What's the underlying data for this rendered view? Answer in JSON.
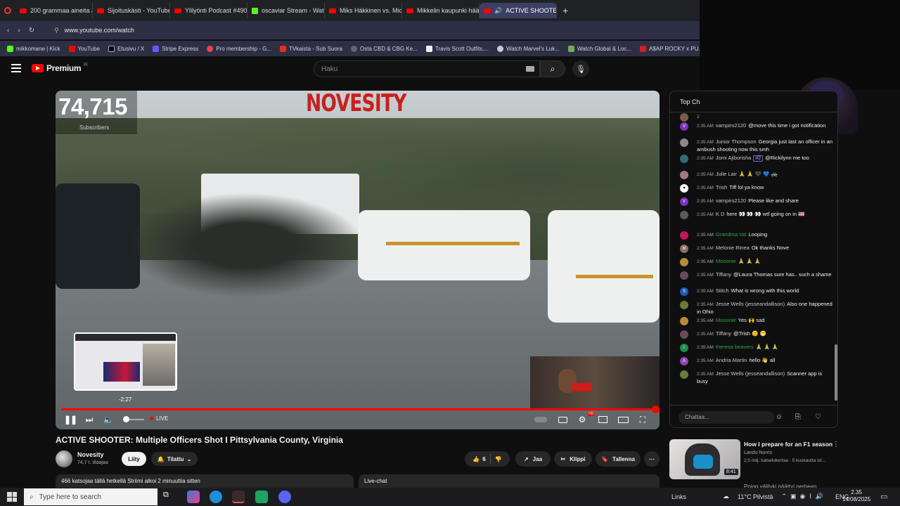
{
  "browser": {
    "tabs": [
      {
        "label": "200 grammaa aineita auto",
        "icon": "youtube-icon"
      },
      {
        "label": "Sijoituskästi - YouTube",
        "icon": "youtube-icon"
      },
      {
        "label": "Ylilyönti Podcast #490 – Ul",
        "icon": "youtube-icon"
      },
      {
        "label": "oscaviar Stream - Watch L",
        "icon": "kick-icon"
      },
      {
        "label": "Miks Häkkinen vs. Michae",
        "icon": "youtube-icon"
      },
      {
        "label": "Mikkelin kaupunki häätsi",
        "icon": "youtube-icon"
      },
      {
        "label": "ACTIVE SHOOTER: M",
        "icon": "youtube-icon",
        "active": true
      }
    ],
    "new_tab": "+",
    "url": "www.youtube.com/watch",
    "bookmarks": [
      "mikkomane | Kick",
      "YouTube",
      "Etusivu / X",
      "Stripe Express",
      "Pro membership - G...",
      "TVkaista - Sub Suora",
      "Osta CBD & CBG Ke...",
      "Travis Scott Outfits,...",
      "Watch Marvel's Luk...",
      "Watch Global & Loc...",
      "A$AP ROCKY x PU...",
      "de"
    ]
  },
  "masthead": {
    "logo_text": "Premium",
    "logo_region": "FI",
    "search_placeholder": "Haku"
  },
  "player": {
    "subs_count": "74,715",
    "subs_label": "Subscribers",
    "brand_overlay": "NOVESITY",
    "preview_time": "-2:27",
    "live_label": "LIVE",
    "progress": 1.0,
    "hd_badge": "HD"
  },
  "video": {
    "title": "ACTIVE SHOOTER: Multiple Officers Shot I Pittsylvania County, Virginia",
    "channel_name": "Novesity",
    "channel_subs": "74,7 t. tilaajaa",
    "join_label": "Liity",
    "subscribed_label": "Tilattu",
    "like_count": "6",
    "share_label": "Jaa",
    "clip_label": "Klippi",
    "save_label": "Tallenna",
    "viewers_text": "466 katsojaa tällä hetkellä  Striimi alkoi 2 minuuttia sitten",
    "livechat_label": "Live-chat"
  },
  "chat": {
    "header": "Top Ch",
    "messages": [
      {
        "time": "2",
        "author": "",
        "text": "",
        "color": "#7a5c4a",
        "initial": ""
      },
      {
        "time": "2:35 AM",
        "author": "vampiro2120",
        "text": "@move this time i got notification",
        "color": "#7a33b8",
        "initial": "V"
      },
      {
        "time": "2:35 AM",
        "author": "Junior Thompson",
        "text": "Georgia just last an officer in an ambush shooting now this smh",
        "color": "#8a8a8a",
        "initial": ""
      },
      {
        "time": "2:35 AM",
        "author": "Jomi Ajiborisha",
        "text": "@Rickilynn me too",
        "badge": "#2",
        "color": "#2f6c7a",
        "initial": ""
      },
      {
        "time": "2:35 AM",
        "author": "Julie Lair",
        "text": "🙏 🙏 🖤 💙 🚓",
        "color": "#a07a8a",
        "initial": ""
      },
      {
        "time": "2:35 AM",
        "author": "Trish",
        "text": "Tiff lol ya know",
        "color": "#ffffff",
        "initial": "♥"
      },
      {
        "time": "2:35 AM",
        "author": "vampiro2120",
        "text": "Please like and share",
        "color": "#7a33b8",
        "initial": "V"
      },
      {
        "time": "2:35 AM",
        "author": "K D",
        "text": "here 👀 👀 👀 wtf going on in 🇺🇸",
        "color": "#5a5a5a",
        "initial": ""
      },
      {
        "time": "2:35 AM",
        "author": "Grandma Val",
        "text": "Looping",
        "color": "#c2185b",
        "initial": "",
        "member": true
      },
      {
        "time": "2:35 AM",
        "author": "Melonie Rinea",
        "text": "Ok thanks Nove",
        "color": "#8d6e63",
        "initial": "M"
      },
      {
        "time": "2:35 AM",
        "author": "Mooonie",
        "text": "🙏 🙏 🙏",
        "color": "#b88a3a",
        "initial": "",
        "member": true
      },
      {
        "time": "2:35 AM",
        "author": "Tiffany",
        "text": "@Laura Thomas sure has.. such a shame",
        "color": "#6a4a5a",
        "initial": ""
      },
      {
        "time": "2:35 AM",
        "author": "Stitch",
        "text": "What is wrong with this world",
        "color": "#1e5bb8",
        "initial": "S"
      },
      {
        "time": "2:35 AM",
        "author": "Jesse Wells (jesseandallison)",
        "text": "Also one happened in Ohio",
        "color": "#6a7a3a",
        "initial": ""
      },
      {
        "time": "2:35 AM",
        "author": "Mooonie",
        "text": "Yes 🙌 sad",
        "color": "#b88a3a",
        "initial": "",
        "member": true
      },
      {
        "time": "2:35 AM",
        "author": "Tiffany",
        "text": "@Trish 😊 😁",
        "color": "#6a4a5a",
        "initial": ""
      },
      {
        "time": "2:35 AM",
        "author": "theresa beavers",
        "text": "🙏 🙏 🙏",
        "color": "#1e8a4a",
        "initial": "t",
        "member": true
      },
      {
        "time": "2:35 AM",
        "author": "Andria Martin",
        "text": "hello 👋 all",
        "color": "#8e44ad",
        "initial": "A"
      },
      {
        "time": "2:35 AM",
        "author": "Jesse Wells (jesseandallison)",
        "text": "Scanner app is busy",
        "color": "#6a7a3a",
        "initial": ""
      }
    ],
    "input_placeholder": "Chattaa..."
  },
  "recommendation": {
    "title": "How I prepare for an F1 season",
    "channel": "Lando Norris",
    "meta": "2,5 milj. katselukertaa · 5 kuukautta sit...",
    "duration": "8:41",
    "next_title": "Poigg välilyki päättyi perheen..."
  },
  "taskbar": {
    "search_placeholder": "Type here to search",
    "links": "Links",
    "weather": "11°C  Pilvistä",
    "lang": "ENG",
    "time": "2.35",
    "date": "14/08/2025"
  }
}
